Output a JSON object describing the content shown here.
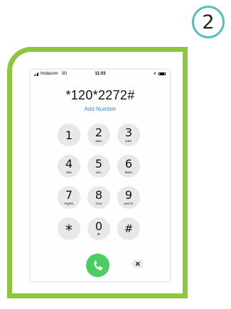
{
  "step_number": "2",
  "status_bar": {
    "carrier": "Vodacom",
    "network": "3G",
    "time": "11:03"
  },
  "dialer": {
    "number": "*120*2272#",
    "add_number_label": "Add Number",
    "keys": [
      {
        "digit": "1",
        "letters": ""
      },
      {
        "digit": "2",
        "letters": "ABC"
      },
      {
        "digit": "3",
        "letters": "DEF"
      },
      {
        "digit": "4",
        "letters": "GHI"
      },
      {
        "digit": "5",
        "letters": "JKL"
      },
      {
        "digit": "6",
        "letters": "MNO"
      },
      {
        "digit": "7",
        "letters": "PQRS"
      },
      {
        "digit": "8",
        "letters": "TUV"
      },
      {
        "digit": "9",
        "letters": "WXYZ"
      },
      {
        "digit": "*",
        "letters": ""
      },
      {
        "digit": "0",
        "letters": "+"
      },
      {
        "digit": "#",
        "letters": ""
      }
    ]
  },
  "icons": {
    "call": "phone-call-icon",
    "delete": "backspace-icon",
    "signal": "signal-bars-icon",
    "location": "location-arrow-icon",
    "battery": "battery-icon"
  },
  "colors": {
    "frame": "#8cc63f",
    "badge": "#56bfb9",
    "call_button": "#4ccd63",
    "link": "#3a86f0",
    "key": "#e8e8e8"
  }
}
